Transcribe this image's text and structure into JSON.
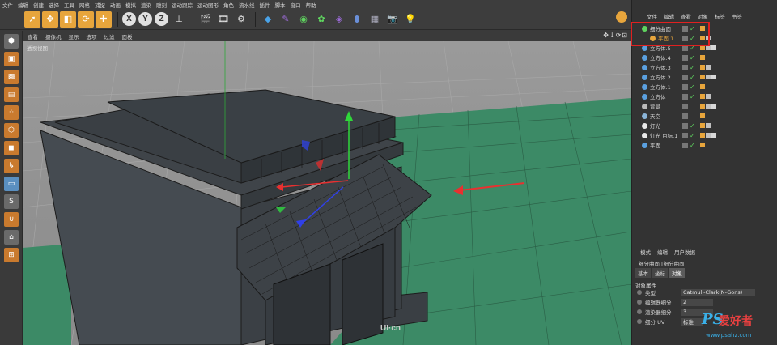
{
  "menubar": {
    "items": [
      "文件",
      "编辑",
      "创建",
      "选择",
      "工具",
      "网格",
      "捕捉",
      "动画",
      "模拟",
      "渲染",
      "雕刻",
      "运动跟踪",
      "运动图形",
      "角色",
      "流水线",
      "插件",
      "脚本",
      "窗口",
      "帮助"
    ]
  },
  "toolbar": {
    "undo_icon": "undo-icon",
    "axis_labels": [
      "X",
      "Y",
      "Z"
    ]
  },
  "viewport": {
    "menu": [
      "查看",
      "摄像机",
      "显示",
      "选项",
      "过滤",
      "面板"
    ],
    "label": "透视视图",
    "nav_icons": "✥↓⟳⊡",
    "watermark": "UI·cn"
  },
  "object_manager": {
    "tabs": [
      "文件",
      "编辑",
      "查看",
      "对象",
      "标签",
      "书签"
    ],
    "objects": [
      {
        "name": "细分曲面",
        "indent": 0,
        "icon_color": "#5fd35f",
        "checked": true
      },
      {
        "name": "平面.1",
        "indent": 1,
        "icon_color": "#e7a53c",
        "checked": true
      },
      {
        "name": "立方体.5",
        "indent": 0,
        "icon_color": "#5aa0e0",
        "checked": true
      },
      {
        "name": "立方体.4",
        "indent": 0,
        "icon_color": "#5aa0e0",
        "checked": true
      },
      {
        "name": "立方体.3",
        "indent": 0,
        "icon_color": "#5aa0e0",
        "checked": true
      },
      {
        "name": "立方体.2",
        "indent": 0,
        "icon_color": "#5aa0e0",
        "checked": true
      },
      {
        "name": "立方体.1",
        "indent": 0,
        "icon_color": "#5aa0e0",
        "checked": true
      },
      {
        "name": "立方体",
        "indent": 0,
        "icon_color": "#5aa0e0",
        "checked": true
      },
      {
        "name": "背景",
        "indent": 0,
        "icon_color": "#bbbbbb",
        "checked": false
      },
      {
        "name": "天空",
        "indent": 0,
        "icon_color": "#8ab4d8",
        "checked": false
      },
      {
        "name": "灯光",
        "indent": 0,
        "icon_color": "#e8e8e8",
        "checked": true
      },
      {
        "name": "灯光 目标.1",
        "indent": 0,
        "icon_color": "#e8e8e8",
        "checked": true
      },
      {
        "name": "平面",
        "indent": 0,
        "icon_color": "#5aa0e0",
        "checked": true
      }
    ]
  },
  "attributes": {
    "tabs": [
      "模式",
      "编辑",
      "用户数据"
    ],
    "title": "细分曲面 [细分曲面]",
    "sub_tabs": [
      "基本",
      "坐标",
      "对象"
    ],
    "active_sub_tab": "对象",
    "section": "对象属性",
    "rows": [
      {
        "label": "类型",
        "value": "Catmull-Clark(N-Gons)"
      },
      {
        "label": "编辑器细分",
        "value": "2"
      },
      {
        "label": "渲染器细分",
        "value": "3"
      },
      {
        "label": "细分 UV",
        "value": "标准"
      }
    ]
  },
  "watermark": {
    "ps": "PS",
    "cn": "爱好者",
    "url": "www.psahz.com"
  },
  "colors": {
    "accent": "#e7a53c",
    "highlight": "#e02020",
    "ground": "#2f7a5a",
    "sky": "#8f8f8f"
  }
}
